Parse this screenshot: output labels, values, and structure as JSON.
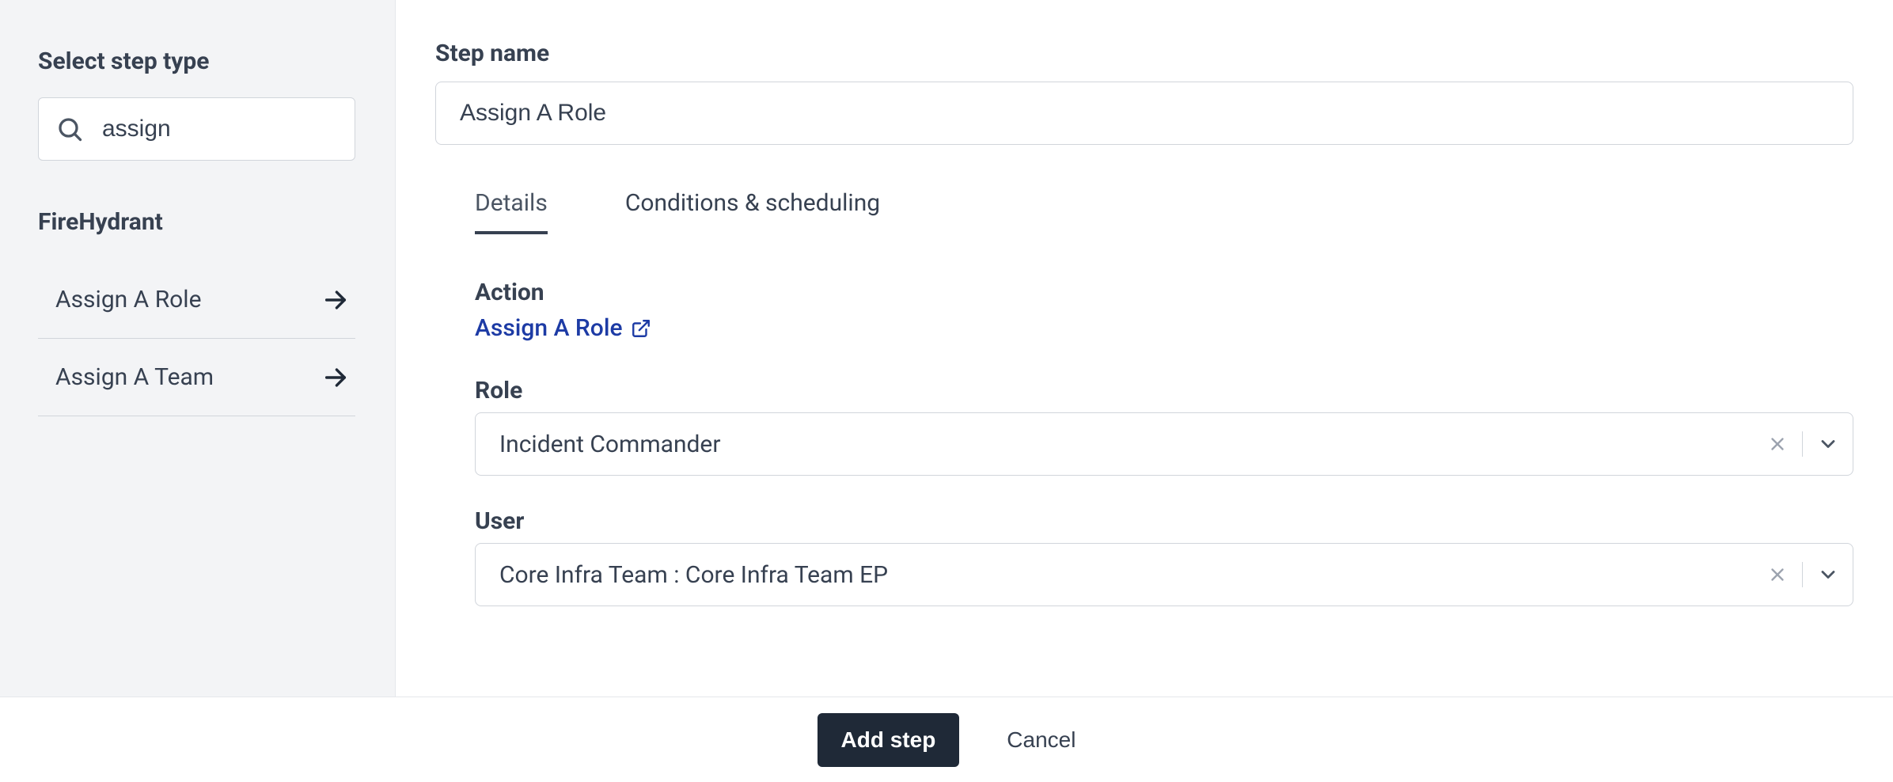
{
  "sidebar": {
    "heading": "Select step type",
    "search_value": "assign",
    "group_title": "FireHydrant",
    "items": [
      {
        "label": "Assign A Role"
      },
      {
        "label": "Assign A Team"
      }
    ]
  },
  "main": {
    "step_name_label": "Step name",
    "step_name_value": "Assign A Role",
    "tabs": [
      {
        "label": "Details",
        "active": true
      },
      {
        "label": "Conditions & scheduling",
        "active": false
      }
    ],
    "action_label": "Action",
    "action_link_text": "Assign A Role",
    "role_label": "Role",
    "role_value": "Incident Commander",
    "user_label": "User",
    "user_value": "Core Infra Team : Core Infra Team EP"
  },
  "footer": {
    "primary_label": "Add step",
    "cancel_label": "Cancel"
  }
}
